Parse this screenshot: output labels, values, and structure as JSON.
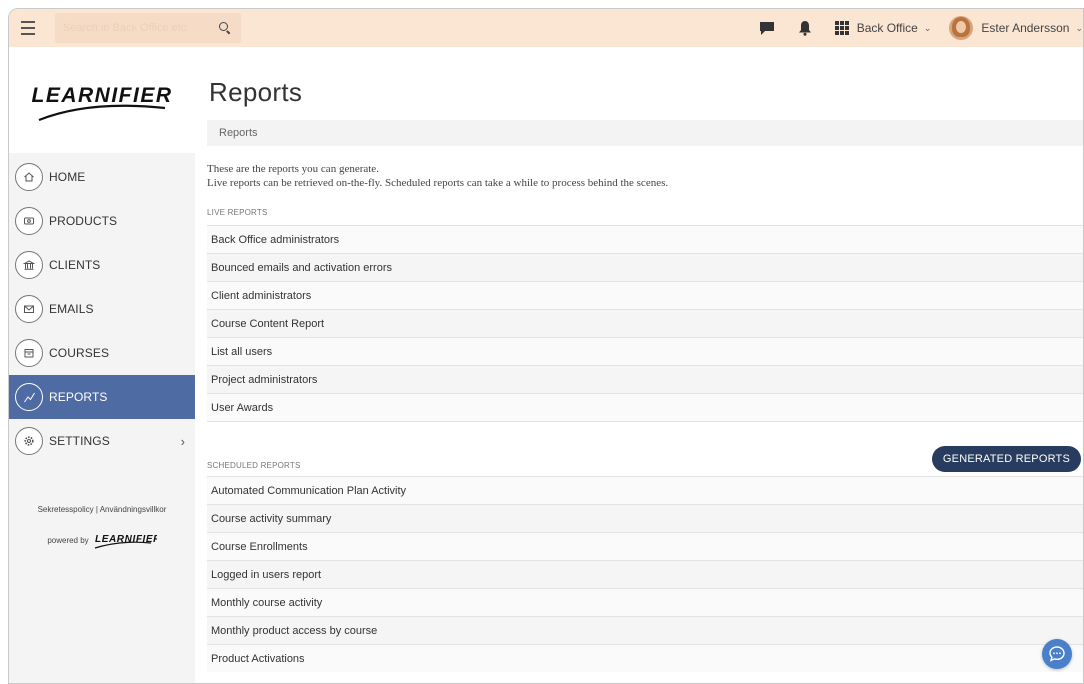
{
  "topbar": {
    "search_placeholder": "Search in Back Office etc.",
    "app_switch_label": "Back Office",
    "user_name": "Ester Andersson"
  },
  "sidebar": {
    "logo_text": "LEARNIFIER",
    "items": [
      {
        "label": "HOME",
        "icon": "home-icon"
      },
      {
        "label": "PRODUCTS",
        "icon": "products-icon"
      },
      {
        "label": "CLIENTS",
        "icon": "clients-icon"
      },
      {
        "label": "EMAILS",
        "icon": "emails-icon"
      },
      {
        "label": "COURSES",
        "icon": "courses-icon"
      },
      {
        "label": "REPORTS",
        "icon": "reports-icon",
        "active": true
      },
      {
        "label": "SETTINGS",
        "icon": "settings-icon"
      }
    ],
    "footer_links": "Sekretesspolicy | Användningsvillkor",
    "powered_by": "powered by",
    "powered_logo": "LEARNIFIER"
  },
  "main": {
    "title": "Reports",
    "breadcrumb": "Reports",
    "intro_line1": "These are the reports you can generate.",
    "intro_line2": "Live reports can be retrieved on-the-fly. Scheduled reports can take a while to process behind the scenes.",
    "live_label": "LIVE REPORTS",
    "live_reports": [
      "Back Office administrators",
      "Bounced emails and activation errors",
      "Client administrators",
      "Course Content Report",
      "List all users",
      "Project administrators",
      "User Awards"
    ],
    "scheduled_label": "SCHEDULED REPORTS",
    "generated_button": "GENERATED REPORTS",
    "scheduled_reports": [
      "Automated Communication Plan Activity",
      "Course activity summary",
      "Course Enrollments",
      "Logged in users report",
      "Monthly course activity",
      "Monthly product access by course",
      "Product Activations"
    ]
  },
  "colors": {
    "topbar_bg": "#fbe6d4",
    "active_nav": "#4f6ba3",
    "primary_button": "#273c5e",
    "chat_fab": "#4a7fc9"
  }
}
